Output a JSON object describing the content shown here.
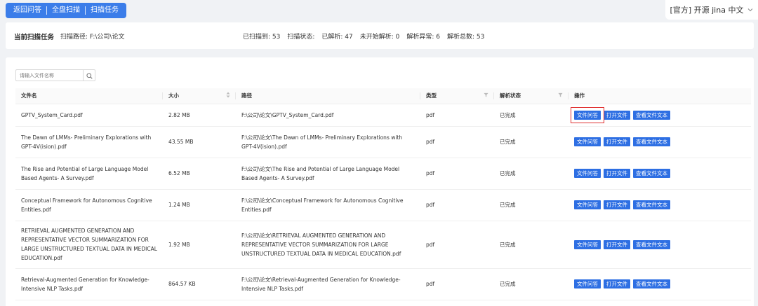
{
  "topnav": {
    "items": [
      "返回问答",
      "全盘扫描",
      "扫描任务"
    ]
  },
  "topright": {
    "text": "[官方] 开源 jina 中文"
  },
  "taskbar": {
    "title": "当前扫描任务",
    "path": "扫描路径: F:\\公司\\论文",
    "stats": [
      "已扫描到: 53",
      "扫描状态:",
      "已解析: 47",
      "未开始解析: 0",
      "解析异常: 6",
      "解析总数: 53"
    ]
  },
  "search": {
    "placeholder": "请输入文件名称"
  },
  "table": {
    "headers": [
      "文件名",
      "大小",
      "路径",
      "类型",
      "解析状态",
      "操作"
    ],
    "actions": [
      "文件问答",
      "打开文件",
      "查看文件文本"
    ],
    "rows": [
      {
        "name": "GPTV_System_Card.pdf",
        "size": "2.82 MB",
        "path": "F:\\公司\\论文\\GPTV_System_Card.pdf",
        "type": "pdf",
        "status": "已完成"
      },
      {
        "name": "The Dawn of LMMs- Preliminary Explorations with GPT-4V(ision).pdf",
        "size": "43.55 MB",
        "path": "F:\\公司\\论文\\The Dawn of LMMs- Preliminary Explorations with GPT-4V(ision).pdf",
        "type": "pdf",
        "status": "已完成"
      },
      {
        "name": "The Rise and Potential of Large Language Model Based Agents- A Survey.pdf",
        "size": "6.52 MB",
        "path": "F:\\公司\\论文\\The Rise and Potential of Large Language Model Based Agents- A Survey.pdf",
        "type": "pdf",
        "status": "已完成"
      },
      {
        "name": "Conceptual Framework for Autonomous Cognitive Entities.pdf",
        "size": "1.24 MB",
        "path": "F:\\公司\\论文\\Conceptual Framework for Autonomous Cognitive Entities.pdf",
        "type": "pdf",
        "status": "已完成"
      },
      {
        "name": "RETRIEVAL AUGMENTED GENERATION AND REPRESENTATIVE VECTOR SUMMARIZATION FOR LARGE UNSTRUCTURED TEXTUAL DATA IN MEDICAL EDUCATION.pdf",
        "size": "1.92 MB",
        "path": "F:\\公司\\论文\\RETRIEVAL AUGMENTED GENERATION AND REPRESENTATIVE VECTOR SUMMARIZATION FOR LARGE UNSTRUCTURED TEXTUAL DATA IN MEDICAL EDUCATION.pdf",
        "type": "pdf",
        "status": "已完成"
      },
      {
        "name": "Retrieval-Augmented Generation for Knowledge-Intensive NLP Tasks.pdf",
        "size": "864.57 KB",
        "path": "F:\\公司\\论文\\Retrieval-Augmented Generation for Knowledge-Intensive NLP Tasks.pdf",
        "type": "pdf",
        "status": "已完成"
      }
    ]
  },
  "colors": {
    "accent": "#2e6fe3",
    "nav": "#3b7de9",
    "highlight": "#e03131"
  },
  "icons": {
    "search": "search-icon",
    "sort": "sort-icon",
    "filter": "filter-icon",
    "dropdown": "chevron-down-icon"
  }
}
